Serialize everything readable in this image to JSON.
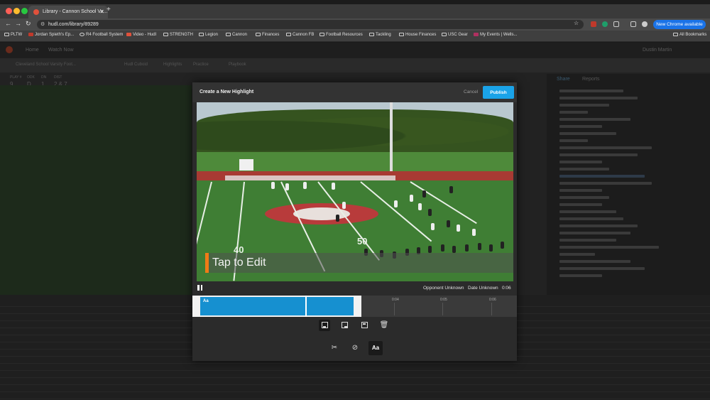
{
  "browser": {
    "tab_title": "Library - Cannon School Va...",
    "url": "hudl.com/library/89289",
    "new_chrome_label": "New Chrome available",
    "bookmarks": [
      "PLTW",
      "Jordan Spieth's Ep...",
      "R4 Football System",
      "Video - Hudl",
      "STRENGTH",
      "Legion",
      "Cannon",
      "Finances",
      "Cannon FB",
      "Football Resources",
      "Tackling",
      "House Finances",
      "USC Gear",
      "My Events | Wells..."
    ],
    "all_bookmarks": "All Bookmarks"
  },
  "modal": {
    "title": "Create a New Highlight",
    "cancel_label": "Cancel",
    "publish_label": "Publish",
    "overlay_text": "Tap to Edit",
    "opponent": "Opponent Unknown",
    "date": "Date Unknown",
    "duration": "0:06",
    "timeline": {
      "clip_label": "Aa",
      "ticks": [
        "0:04",
        "0:05",
        "0:06"
      ]
    },
    "yard_numbers": [
      "40",
      "50"
    ]
  },
  "background_app": {
    "nav": [
      "Home",
      "Watch Now"
    ],
    "user": "Dustin Martin",
    "clip_title": "Cleveland School Varsity Foot...",
    "sub_tabs": [
      "Hudl Cuboid",
      "Highlights",
      "Practice",
      "Playbook"
    ],
    "stats_headers": [
      "PLAY #",
      "ODK",
      "DN",
      "DIST"
    ],
    "stats_values": [
      "9",
      "D",
      "1",
      "2 & 7"
    ],
    "right_tabs": [
      "Share",
      "Reports"
    ]
  },
  "colors": {
    "accent": "#1aa3e8",
    "overlay_bar": "#f07b16",
    "modal_bg": "#2b2b2b"
  }
}
